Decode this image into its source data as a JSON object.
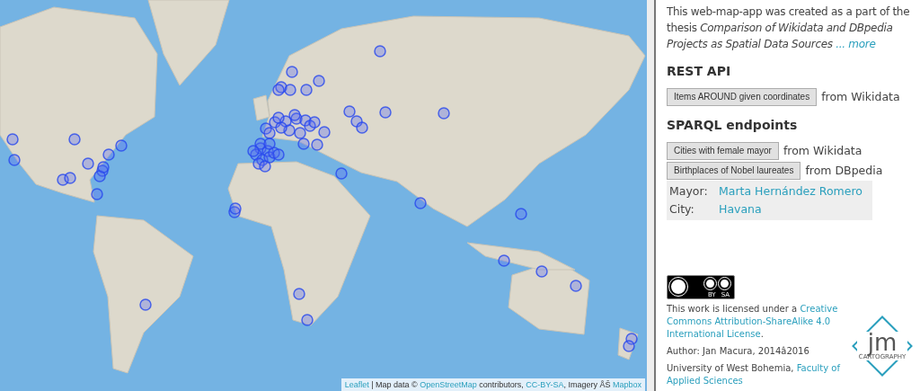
{
  "map": {
    "attribution": {
      "leaflet_link": "Leaflet",
      "text_1": " | Map data © ",
      "osm_link": "OpenStreetMap",
      "text_2": " contributors, ",
      "license_link": "CC-BY-SA",
      "text_3": ", Imagery ÅŠ ",
      "imagery_link": "Mapbox"
    }
  },
  "sidebar": {
    "intro": {
      "text": "This web-map-app was created as a part of the thesis *Comparison of Wikidata and DBpedia Projects as Spatial Data Sources*",
      "more_link": "... more"
    },
    "sections": [
      {
        "heading": "REST API",
        "queries": [
          {
            "button": "Items AROUND given coordinates",
            "source": "from Wikidata"
          }
        ]
      },
      {
        "heading": "SPARQL endpoints",
        "queries": [
          {
            "button": "Cities with female mayor",
            "source": "from Wikidata"
          },
          {
            "button": "Birthplaces of Nobel laureates",
            "source": "from DBpedia"
          }
        ]
      }
    ],
    "result": [
      {
        "label": "Mayor:",
        "value": "Marta Hernández Romero"
      },
      {
        "label": "City:",
        "value": "Havana"
      }
    ],
    "license_badge": {
      "by": "BY",
      "sa": "SA"
    },
    "license": {
      "text": "This work is licensed under a ",
      "link_lines": [
        "Creative",
        "Commons Attribution-ShareAlike 4.0",
        "International License"
      ],
      "end": "."
    },
    "author": "Author: Jan Macura, 2014â2016",
    "university": {
      "text": "University of West Bohemia, ",
      "link_lines": [
        "Faculty of",
        "Applied Sciences"
      ]
    },
    "logo": {
      "initials": "jm",
      "caption": "CARTOGRAPHY"
    }
  }
}
